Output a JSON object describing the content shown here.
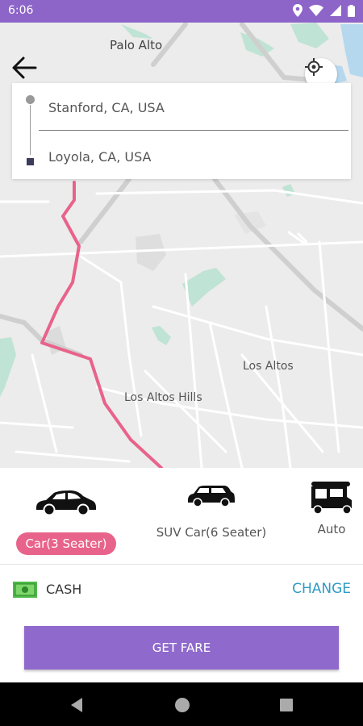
{
  "status_bar": {
    "time": "6:06",
    "icons": [
      "location-icon",
      "wifi-icon",
      "signal-icon",
      "battery-icon"
    ]
  },
  "map": {
    "city_label": "Palo Alto",
    "labels": [
      "Los Altos",
      "Los Altos Hills"
    ],
    "route_color": "#e8638b"
  },
  "route": {
    "pickup": "Stanford, CA, USA",
    "drop": "Loyola, CA, USA"
  },
  "vehicles": [
    {
      "name": "Car(3 Seater)",
      "icon": "sedan-car-icon",
      "selected": true
    },
    {
      "name": "SUV Car(6 Seater)",
      "icon": "suv-car-icon",
      "selected": false
    },
    {
      "name": "Auto",
      "icon": "auto-rickshaw-icon",
      "selected": false
    }
  ],
  "payment": {
    "method": "CASH",
    "change_label": "CHANGE",
    "icon": "cash-icon"
  },
  "get_fare_label": "GET FARE",
  "colors": {
    "primary": "#8d64c8",
    "accent": "#e8638b",
    "link": "#2e9bc5"
  }
}
